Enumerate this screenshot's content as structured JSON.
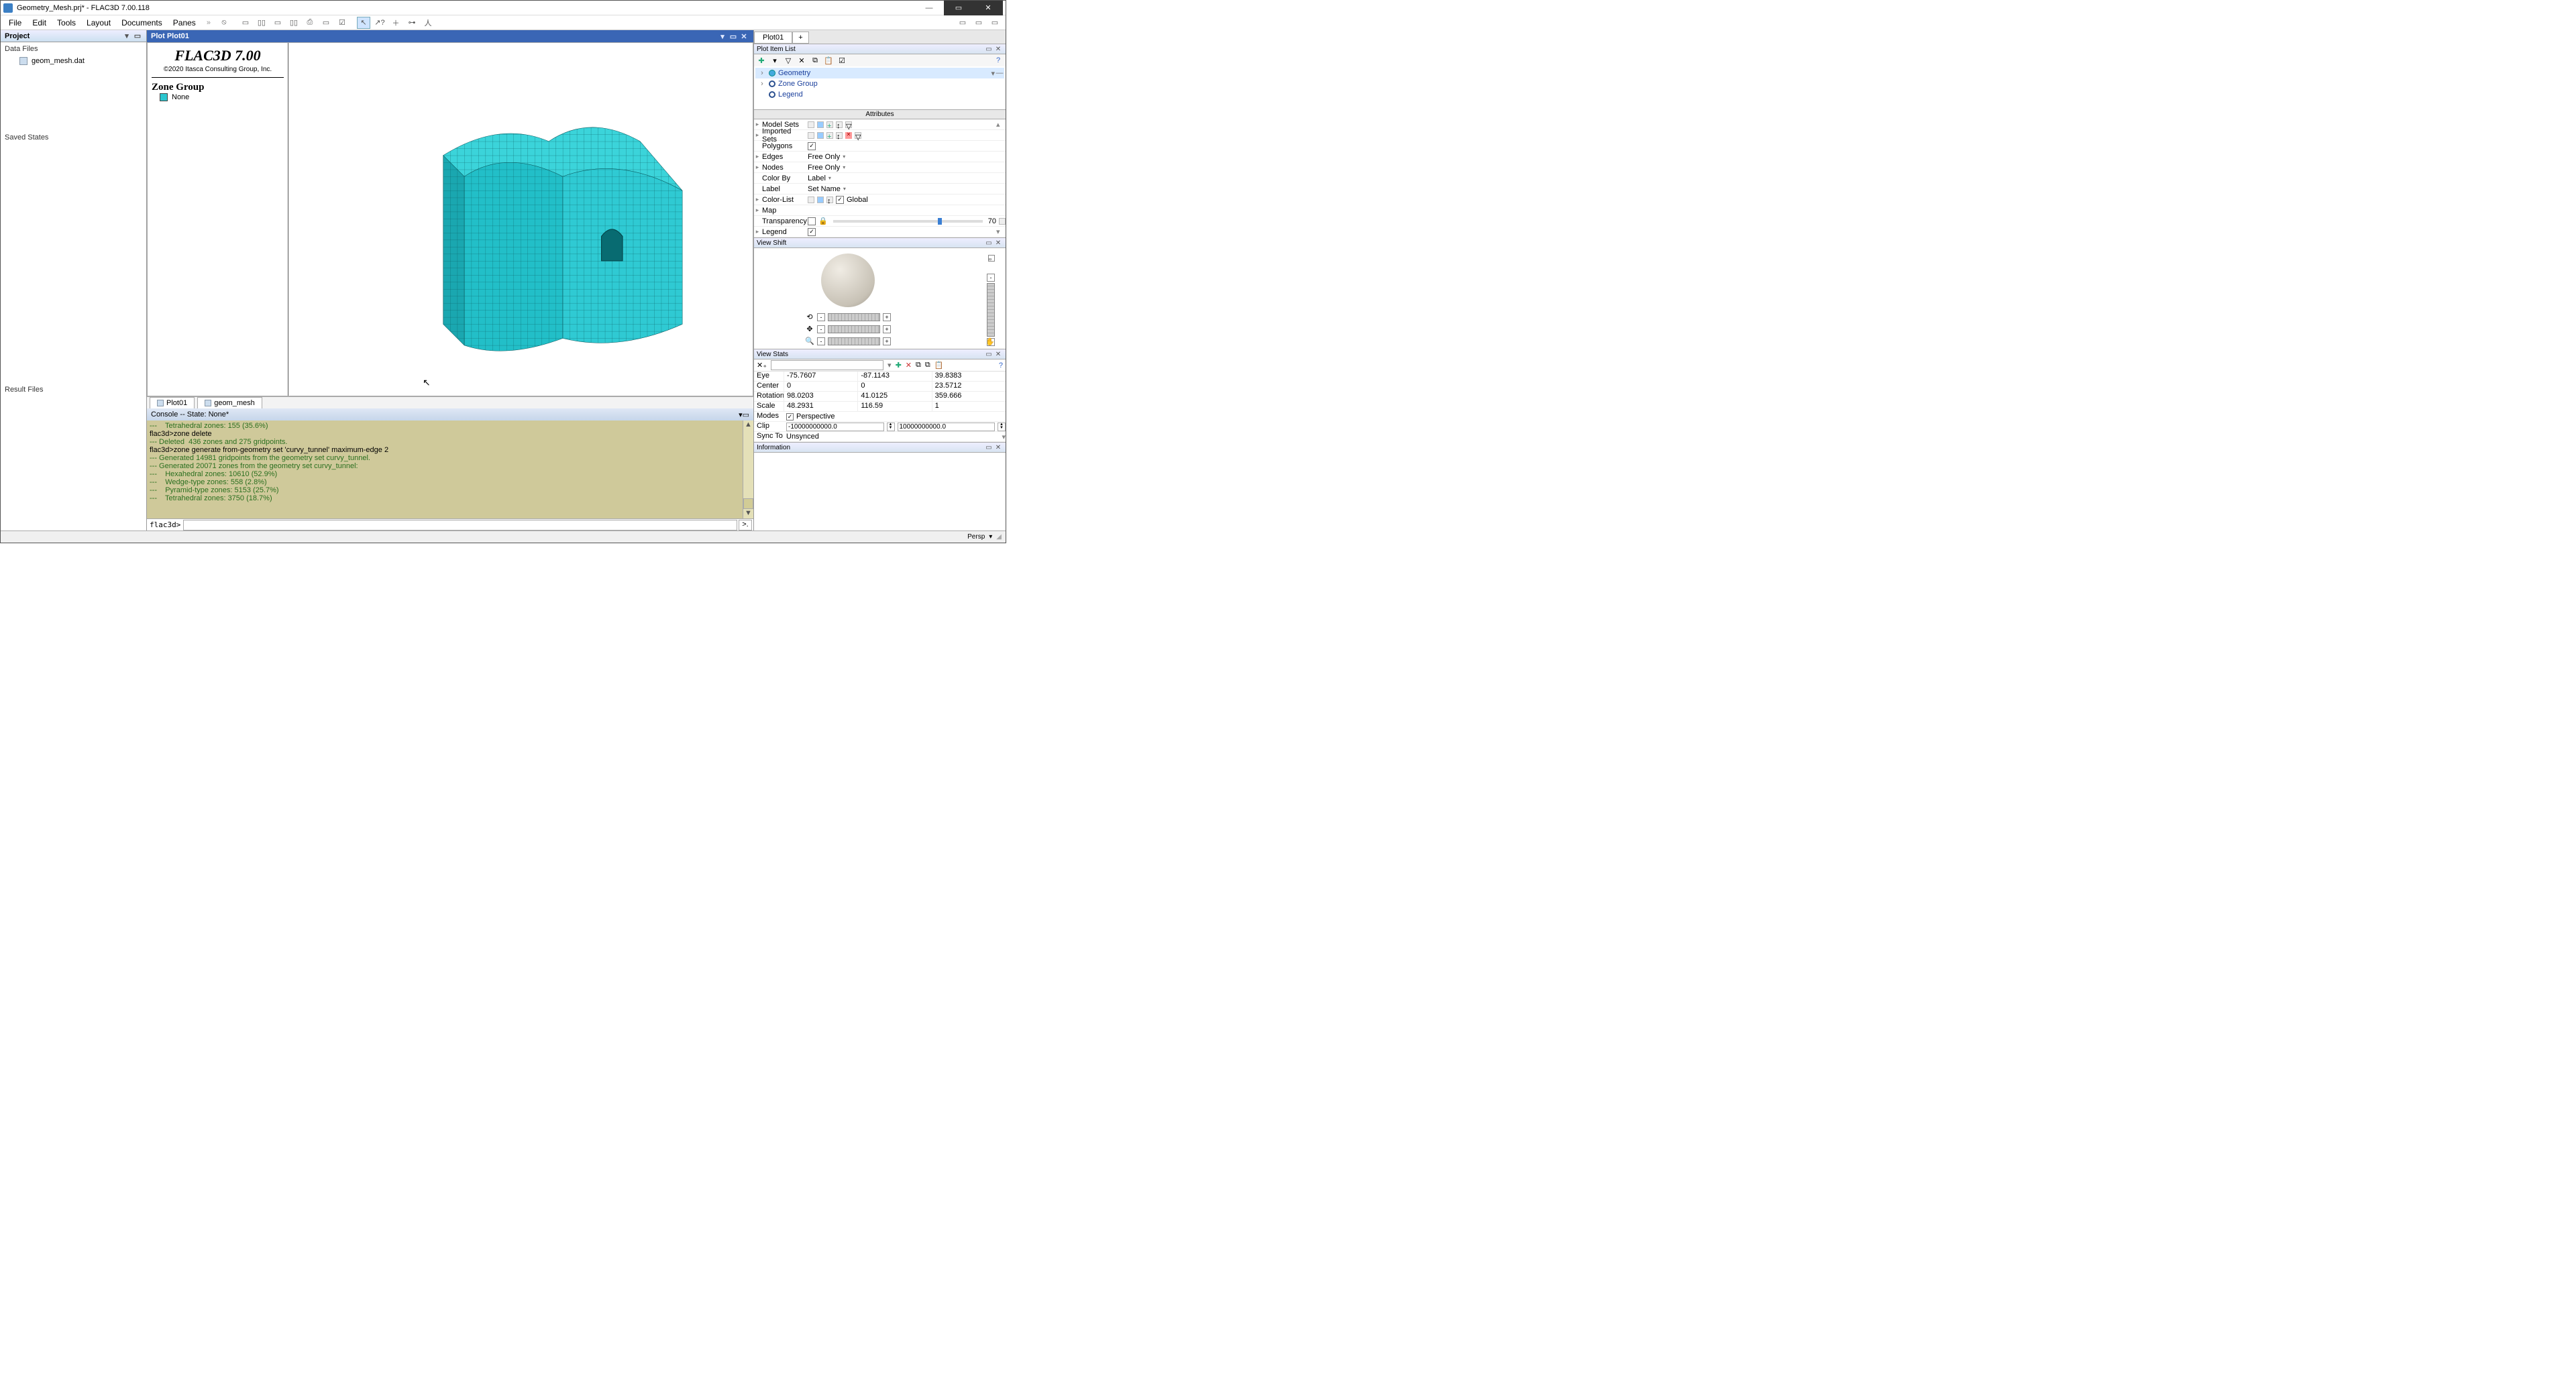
{
  "title": "Geometry_Mesh.prj* - FLAC3D 7.00.118",
  "menus": [
    "File",
    "Edit",
    "Tools",
    "Layout",
    "Documents",
    "Panes"
  ],
  "project": {
    "header": "Project",
    "sections": {
      "data_files": "Data Files",
      "saved_states": "Saved States",
      "result_files": "Result Files"
    },
    "file1": "geom_mesh.dat"
  },
  "plot": {
    "header": "Plot  Plot01",
    "brand": "FLAC3D 7.00",
    "copyright": "©2020 Itasca Consulting Group, Inc.",
    "zg_title": "Zone Group",
    "zg_item": "None"
  },
  "tabs": {
    "t1": "Plot01",
    "t2": "geom_mesh"
  },
  "console": {
    "header": "Console -- State: None*",
    "l0": "---    Tetrahedral zones: 155 (35.6%)",
    "l1": "flac3d>zone delete",
    "l2": "--- Deleted  436 zones and 275 gridpoints.",
    "l3": "flac3d>zone generate from-geometry set 'curvy_tunnel' maximum-edge 2",
    "l4": "--- Generated 14981 gridpoints from the geometry set curvy_tunnel.",
    "l5": "--- Generated 20071 zones from the geometry set curvy_tunnel:",
    "l6": "---    Hexahedral zones: 10610 (52.9%)",
    "l7": "---    Wedge-type zones: 558 (2.8%)",
    "l8": "---    Pyramid-type zones: 5153 (25.7%)",
    "l9": "---    Tetrahedral zones: 3750 (18.7%)",
    "prompt": "flac3d>"
  },
  "rtab": {
    "t1": "Plot01",
    "t2": "+"
  },
  "pil": {
    "header": "Plot Item List",
    "item1": "Geometry",
    "item2": "Zone Group",
    "item3": "Legend"
  },
  "attr": {
    "header": "Attributes",
    "model_sets": "Model Sets",
    "imported_sets": "Imported Sets",
    "polygons": "Polygons",
    "edges": "Edges",
    "edges_val": "Free Only",
    "nodes": "Nodes",
    "nodes_val": "Free Only",
    "color_by": "Color By",
    "color_by_val": "Label",
    "label": "Label",
    "label_val": "Set Name",
    "color_list": "Color-List",
    "global": "Global",
    "map": "Map",
    "transparency": "Transparency",
    "transparency_val": "70",
    "legend": "Legend"
  },
  "viewshift": {
    "header": "View Shift"
  },
  "viewstats": {
    "header": "View Stats",
    "eye": "Eye",
    "eye_x": "-75.7607",
    "eye_y": "-87.1143",
    "eye_z": "39.8383",
    "center": "Center",
    "center_x": "0",
    "center_y": "0",
    "center_z": "23.5712",
    "rotation": "Rotation",
    "rot_x": "98.0203",
    "rot_y": "41.0125",
    "rot_z": "359.666",
    "scale": "Scale",
    "scale_x": "48.2931",
    "scale_y": "116.59",
    "scale_z": "1",
    "modes": "Modes",
    "perspective": "Perspective",
    "clip": "Clip",
    "clip_near": "-10000000000.0",
    "clip_far": "10000000000.0",
    "sync": "Sync To",
    "sync_val": "Unsynced"
  },
  "info": {
    "header": "Information"
  },
  "status": {
    "persp": "Persp"
  }
}
